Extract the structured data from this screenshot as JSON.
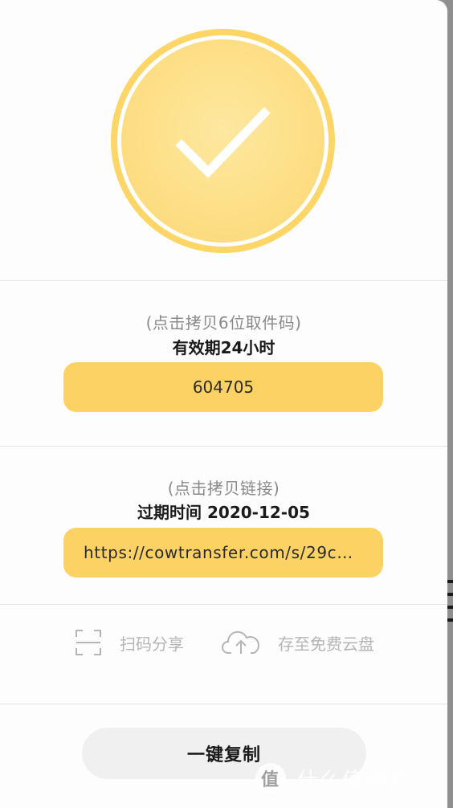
{
  "pickup": {
    "hint": "(点击拷贝6位取件码)",
    "validity": "有效期24小时",
    "code": "604705"
  },
  "link": {
    "hint": "(点击拷贝链接)",
    "expiry": "过期时间 2020-12-05",
    "url": "https://cowtransfer.com/s/29c…"
  },
  "actions": {
    "qr_share": "扫码分享",
    "save_cloud": "存至免费云盘"
  },
  "copy_all": "一键复制",
  "watermark": {
    "logo": "值",
    "text": "什么值得买"
  },
  "icons": {
    "success": "check-icon",
    "qr": "scan-frame-icon",
    "upload": "cloud-upload-icon"
  },
  "colors": {
    "accent": "#fdd265",
    "ring": "#fdd667",
    "muted_text": "#b5b5b5"
  }
}
